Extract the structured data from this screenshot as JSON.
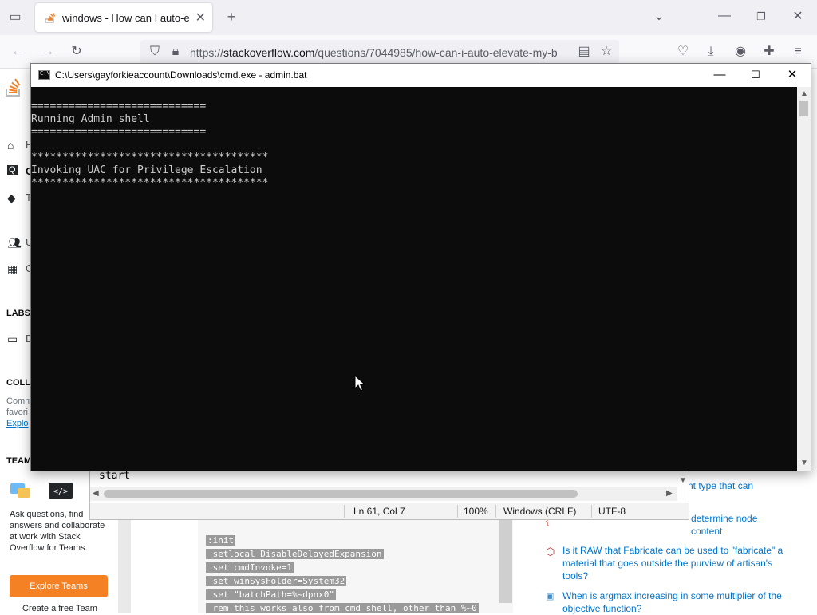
{
  "browser": {
    "tab_title": "windows - How can I auto-eleva",
    "url_prefix": "https://",
    "url_domain": "stackoverflow.com",
    "url_path": "/questions/7044985/how-can-i-auto-elevate-my-b",
    "icons": [
      "tab-list-icon",
      "new-tab-icon",
      "list-all-tabs-icon",
      "minimize-icon",
      "restore-icon",
      "close-icon",
      "back-icon",
      "forward-icon",
      "reload-icon",
      "shield-icon",
      "lock-icon",
      "reader-mode-icon",
      "bookmark-star-icon",
      "pocket-icon",
      "download-icon",
      "account-icon",
      "extensions-icon",
      "menu-icon"
    ]
  },
  "cmd": {
    "title": "C:\\Users\\gayforkieaccount\\Downloads\\cmd.exe - admin.bat",
    "lines": [
      "============================",
      "Running Admin shell",
      "============================",
      "",
      "**************************************",
      "Invoking UAC for Privilege Escalation",
      "**************************************"
    ]
  },
  "notepad": {
    "visible_text": "start",
    "status": {
      "position": "Ln 61, Col 7",
      "zoom": "100%",
      "line_ending": "Windows (CRLF)",
      "encoding": "UTF-8"
    }
  },
  "so": {
    "nav_partial": [
      "H",
      "Q",
      "T",
      "U",
      "C"
    ],
    "labs_heading": "LABS",
    "labs_item_partial": "D",
    "collectives_heading": "COLLE",
    "collectives_lines": [
      "Comm",
      "favori",
      "Explo"
    ],
    "teams_heading": "TEAM",
    "teams_text": "Ask questions, find answers and collaborate at work with Stack Overflow for Teams.",
    "explore_teams": "Explore Teams",
    "create_team": "Create a free Team",
    "code_lines": [
      ":init",
      " setlocal DisableDelayedExpansion",
      " set cmdInvoke=1",
      " set winSysFolder=System32",
      " set \"batchPath=%~dpnx0\"",
      " rem this works also from cmd shell, other than %~0"
    ],
    "hot_questions": [
      {
        "text": "nt type that can",
        "icon": "site-icon"
      },
      {
        "text": "determine node content",
        "icon": "site-icon"
      },
      {
        "text": "Is it RAW that Fabricate can be used to \"fabricate\" a material that goes outside the purview of artisan's tools?",
        "icon": "rpg-icon"
      },
      {
        "text": "When is argmax increasing in some multiplier of the objective function?",
        "icon": "economics-icon"
      }
    ]
  }
}
